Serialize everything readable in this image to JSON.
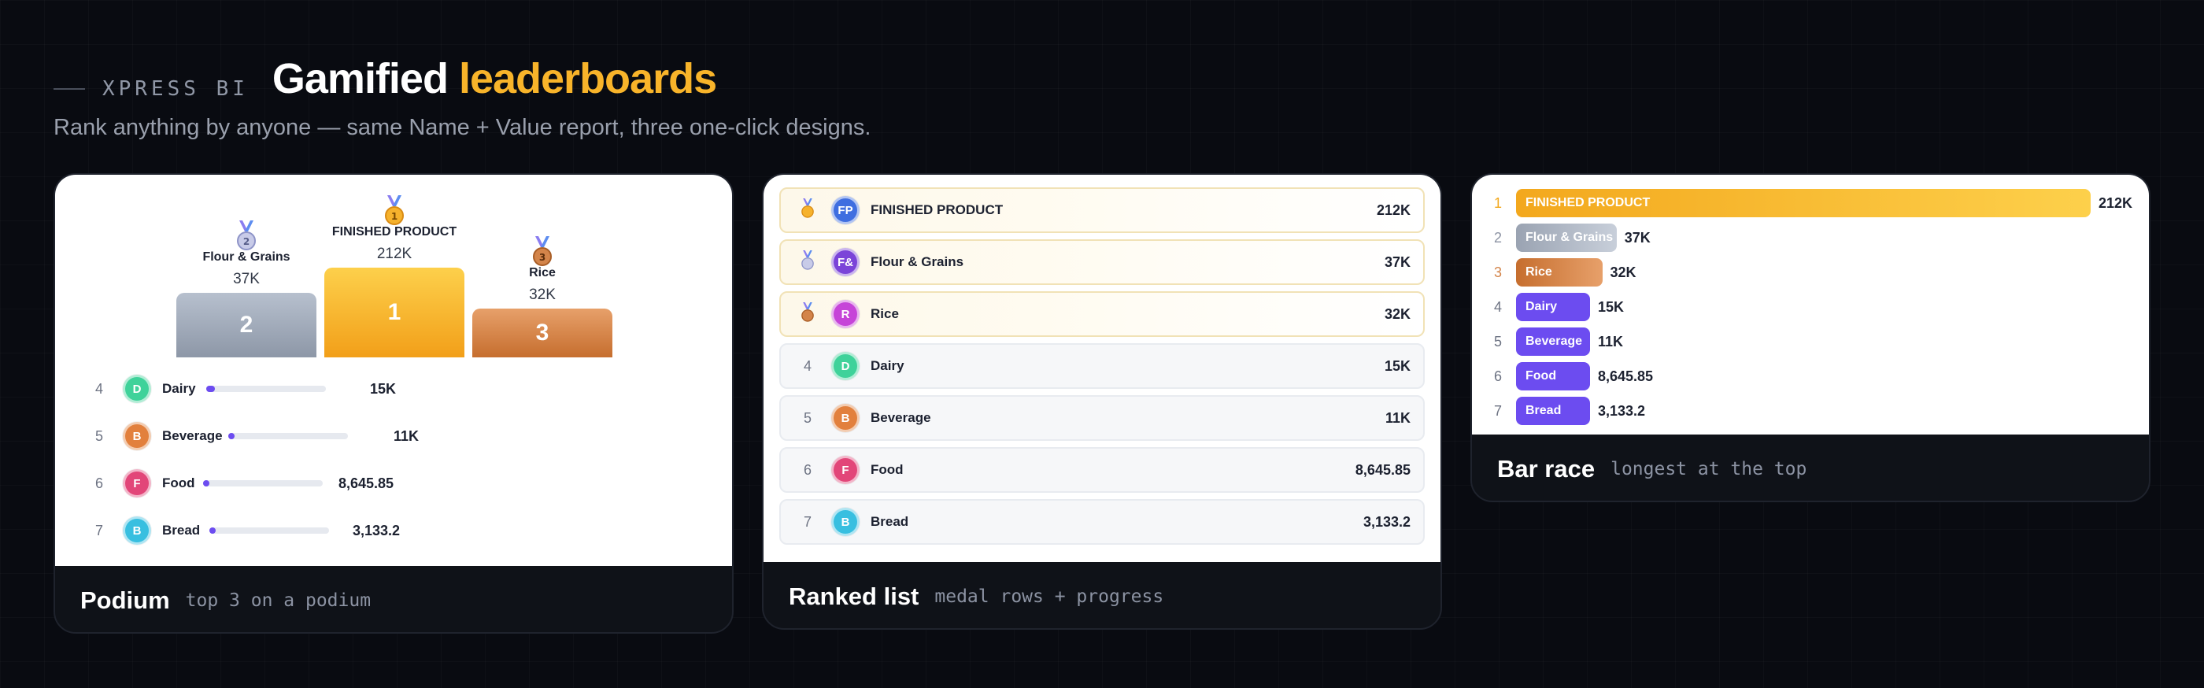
{
  "header": {
    "brand": "XPRESS BI",
    "title_part1": "Gamified",
    "title_part2": "leaderboards",
    "subtitle": "Rank anything by anyone — same Name + Value report, three one-click designs."
  },
  "colors": {
    "accent_gold": "#f8b42a",
    "silver": "#9aa3b2",
    "bronze": "#d3844a",
    "bar_purple": "#6c4cf0"
  },
  "podium_card": {
    "footer_title": "Podium",
    "footer_subtitle": "top 3 on a podium",
    "podium": [
      {
        "rank": "2",
        "name": "Flour & Grains",
        "value": "37K",
        "medal": "2"
      },
      {
        "rank": "1",
        "name": "FINISHED PRODUCT",
        "value": "212K",
        "medal": "1"
      },
      {
        "rank": "3",
        "name": "Rice",
        "value": "32K",
        "medal": "3"
      }
    ],
    "rows": [
      {
        "rank": "4",
        "initial": "D",
        "name": "Dairy",
        "value": "15K",
        "progress": 0.07,
        "color": "#3fd29a"
      },
      {
        "rank": "5",
        "initial": "B",
        "name": "Beverage",
        "value": "11K",
        "progress": 0.05,
        "color": "#e2803d"
      },
      {
        "rank": "6",
        "initial": "F",
        "name": "Food",
        "value": "8,645.85",
        "progress": 0.04,
        "color": "#e24679"
      },
      {
        "rank": "7",
        "initial": "B",
        "name": "Bread",
        "value": "3,133.2",
        "progress": 0.015,
        "color": "#38bfe0"
      }
    ]
  },
  "list_card": {
    "footer_title": "Ranked list",
    "footer_subtitle": "medal rows + progress",
    "rows": [
      {
        "rank": "1",
        "initial": "FP",
        "name": "FINISHED PRODUCT",
        "value": "212K",
        "color": "#3f6ee0",
        "medal": true
      },
      {
        "rank": "2",
        "initial": "F&",
        "name": "Flour & Grains",
        "value": "37K",
        "color": "#7b44d8",
        "medal": true
      },
      {
        "rank": "3",
        "initial": "R",
        "name": "Rice",
        "value": "32K",
        "color": "#c644d8",
        "medal": true
      },
      {
        "rank": "4",
        "initial": "D",
        "name": "Dairy",
        "value": "15K",
        "color": "#3fd29a",
        "medal": false
      },
      {
        "rank": "5",
        "initial": "B",
        "name": "Beverage",
        "value": "11K",
        "color": "#e2803d",
        "medal": false
      },
      {
        "rank": "6",
        "initial": "F",
        "name": "Food",
        "value": "8,645.85",
        "color": "#e24679",
        "medal": false
      },
      {
        "rank": "7",
        "initial": "B",
        "name": "Bread",
        "value": "3,133.2",
        "color": "#38bfe0",
        "medal": false
      }
    ]
  },
  "bar_card": {
    "footer_title": "Bar race",
    "footer_subtitle": "longest at the top",
    "rows": [
      {
        "rank": "1",
        "name": "FINISHED PRODUCT",
        "value": "212K",
        "ratio": 1.0,
        "style": "gold"
      },
      {
        "rank": "2",
        "name": "Flour & Grains",
        "value": "37K",
        "ratio": 0.175,
        "style": "silver"
      },
      {
        "rank": "3",
        "name": "Rice",
        "value": "32K",
        "ratio": 0.15,
        "style": "bronze"
      },
      {
        "rank": "4",
        "name": "Dairy",
        "value": "15K",
        "ratio": 0.07,
        "style": "purple"
      },
      {
        "rank": "5",
        "name": "Beverage",
        "value": "11K",
        "ratio": 0.052,
        "style": "purple"
      },
      {
        "rank": "6",
        "name": "Food",
        "value": "8,645.85",
        "ratio": 0.041,
        "style": "purple"
      },
      {
        "rank": "7",
        "name": "Bread",
        "value": "3,133.2",
        "ratio": 0.015,
        "style": "purple"
      }
    ]
  }
}
